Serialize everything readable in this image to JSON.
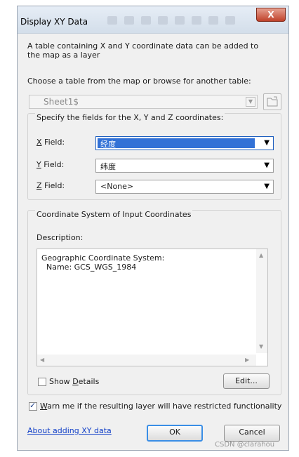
{
  "window": {
    "title": "Display XY Data",
    "close_label": "X"
  },
  "intro_text": "A table containing X and Y coordinate data can be added to the map as a layer",
  "choose_table": {
    "label": "Choose a table from the map or browse for another table:",
    "selected": "Sheet1$"
  },
  "fields_group": {
    "title": "Specify the fields for the X, Y and Z coordinates:",
    "x": {
      "label_key": "X",
      "label_rest": " Field:",
      "value": "经度"
    },
    "y": {
      "label_key": "Y",
      "label_rest": " Field:",
      "value": "纬度"
    },
    "z": {
      "label_key": "Z",
      "label_rest": " Field:",
      "value": "<None>"
    }
  },
  "coord_group": {
    "title": "Coordinate System of Input Coordinates",
    "description_label": "Description:",
    "description_text": "Geographic Coordinate System:\n  Name: GCS_WGS_1984",
    "show_details_prefix": "Show ",
    "show_details_key": "D",
    "show_details_rest": "etails",
    "show_details_checked": false,
    "edit_label": "Edit..."
  },
  "warn": {
    "key": "W",
    "rest": "arn me if the resulting layer will have restricted functionality",
    "checked": true
  },
  "footer": {
    "about_link": "About adding XY data",
    "ok_label": "OK",
    "cancel_label": "Cancel"
  },
  "watermark": "CSDN @clarahou",
  "colors": {
    "selection": "#3271d6",
    "link": "#1240c8",
    "close": "#c0412a",
    "default_border": "#3a8ee6"
  }
}
